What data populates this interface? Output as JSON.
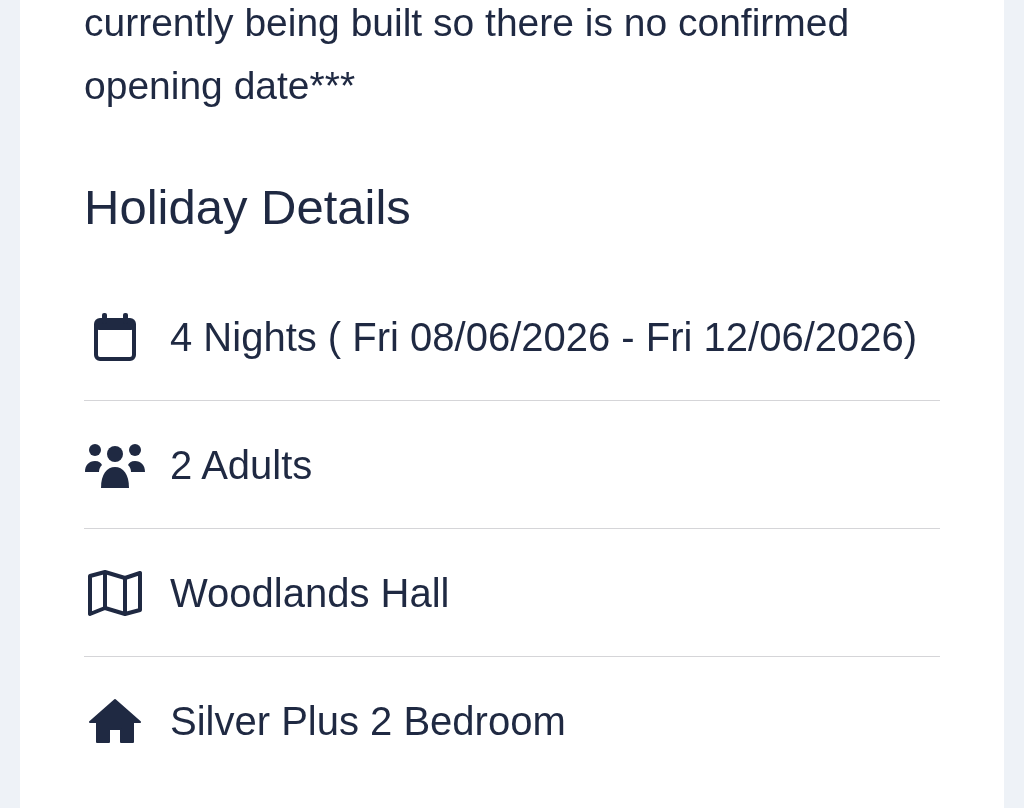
{
  "notice": "currently being built so there is no confirmed opening date***",
  "section_title": "Holiday Details",
  "details": [
    {
      "kind": "dates",
      "text": "4 Nights ( Fri 08/06/2026 - Fri 12/06/2026)"
    },
    {
      "kind": "guests",
      "text": "2 Adults"
    },
    {
      "kind": "location",
      "text": "Woodlands Hall"
    },
    {
      "kind": "accommodation",
      "text": "Silver Plus 2 Bedroom"
    }
  ]
}
